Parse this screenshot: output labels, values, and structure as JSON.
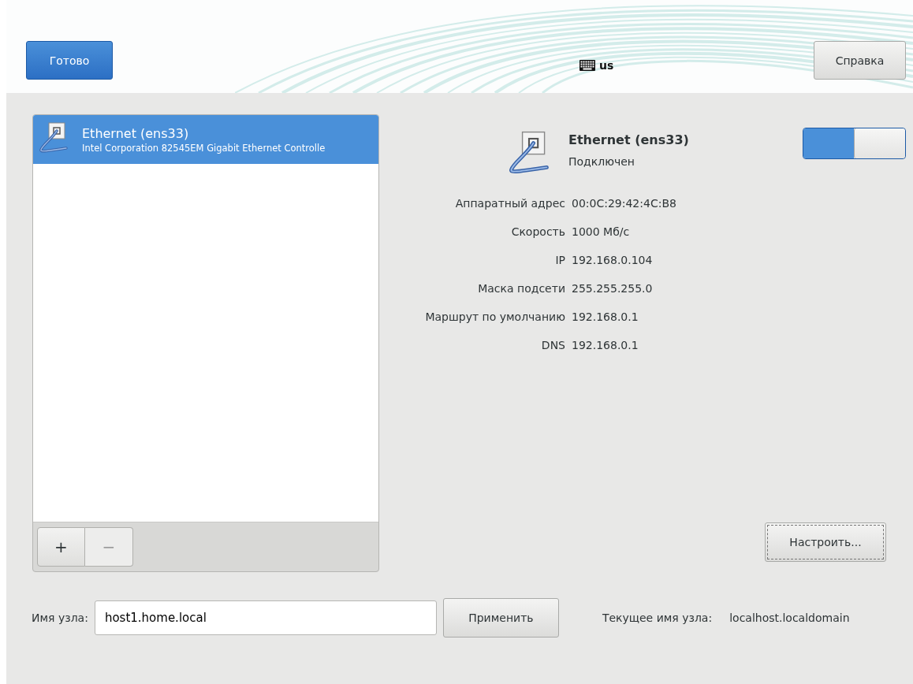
{
  "header": {
    "done_button": "Готово",
    "keyboard_layout": "us",
    "help_button": "Справка"
  },
  "connections": {
    "items": [
      {
        "name": "Ethernet (ens33)",
        "description": "Intel Corporation 82545EM Gigabit Ethernet Controlle",
        "selected": true
      }
    ],
    "add_button": "+",
    "remove_button": {
      "label": "−",
      "disabled": true
    }
  },
  "details": {
    "title": "Ethernet (ens33)",
    "status": "Подключен",
    "switch_on": true,
    "properties": [
      {
        "label": "Аппаратный адрес",
        "value": "00:0C:29:42:4C:B8"
      },
      {
        "label": "Скорость",
        "value": "1000 Мб/с"
      },
      {
        "label": "IP",
        "value": "192.168.0.104"
      },
      {
        "label": "Маска подсети",
        "value": "255.255.255.0"
      },
      {
        "label": "Маршрут по умолчанию",
        "value": "192.168.0.1"
      },
      {
        "label": "DNS",
        "value": "192.168.0.1"
      }
    ],
    "configure_button": "Настроить..."
  },
  "hostname": {
    "label": "Имя узла:",
    "value": "host1.home.local",
    "apply_button": "Применить",
    "current_label": "Текущее имя узла:",
    "current_value": "localhost.localdomain"
  }
}
